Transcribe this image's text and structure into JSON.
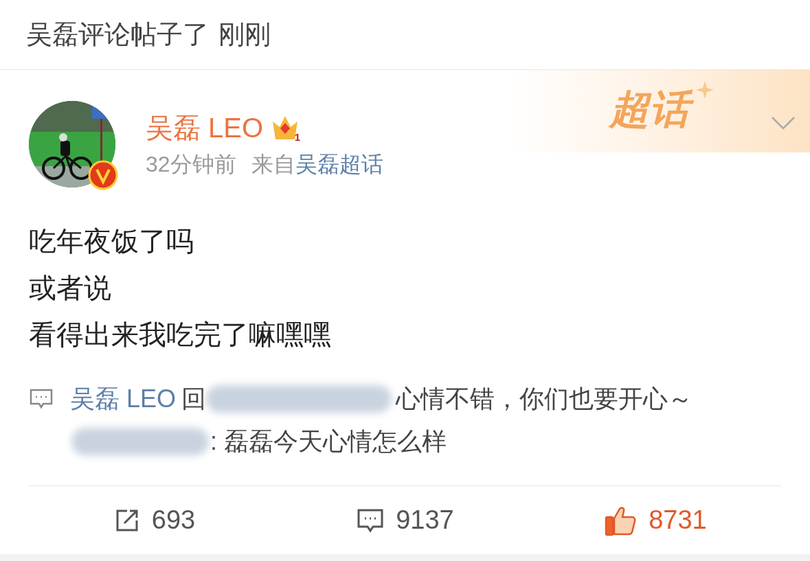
{
  "notice": {
    "text": "吴磊评论帖子了",
    "time": "刚刚"
  },
  "post": {
    "author": "吴磊 LEO",
    "crown_level": "1",
    "verified": true,
    "time": "32分钟前",
    "source_prefix": "来自",
    "source": "吴磊超话",
    "topic_badge": "超话",
    "lines": [
      "吃年夜饭了吗",
      "或者说",
      "看得出来我吃完了嘛嘿嘿"
    ],
    "comments": [
      {
        "kind": "reply",
        "author": "吴磊 LEO",
        "reply_word": "回",
        "text": "心情不错，你们也要开心～"
      },
      {
        "kind": "quote",
        "text": ": 磊磊今天心情怎么样"
      }
    ],
    "actions": [
      {
        "kind": "repost",
        "count": "693",
        "selected": false
      },
      {
        "kind": "comment",
        "count": "9137",
        "selected": false
      },
      {
        "kind": "like",
        "count": "8731",
        "selected": true
      }
    ]
  }
}
